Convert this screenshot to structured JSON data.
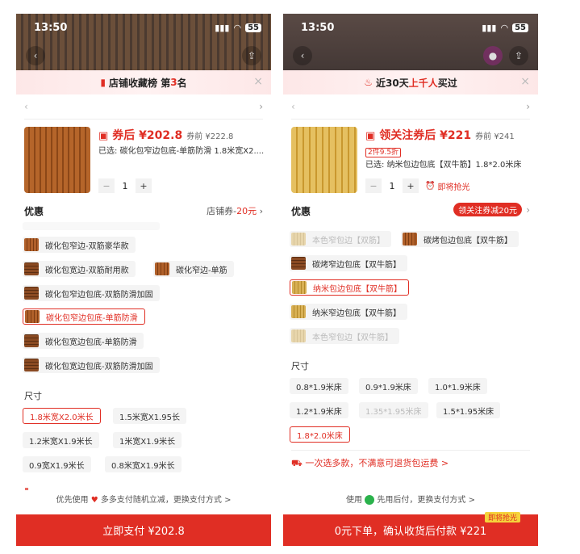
{
  "left": {
    "status_time": "13:50",
    "battery": "55",
    "banner": {
      "prefix": "店铺收藏榜 第 ",
      "rank": "3",
      "suffix": " 名"
    },
    "price_after_coupon": "券后 ¥202.8",
    "price_before": "券前 ¥222.8",
    "selected": "已选: 碳化包窄边包底-单筋防滑 1.8米宽X2....",
    "quantity": "1",
    "discount_label": "优惠",
    "discount_value_prefix": "店铺券-",
    "discount_value_amount": "20元",
    "options": [
      "碳化包窄边-双筋豪华款",
      "碳化包宽边-双筋耐用款",
      "碳化窄边-单筋",
      "碳化包窄边包底-双筋防滑加固",
      "碳化包窄边包底-单筋防滑",
      "碳化包宽边包底-单筋防滑",
      "碳化包宽边包底-双筋防滑加固"
    ],
    "size_title": "尺寸",
    "sizes": [
      "1.8米宽X2.0米长",
      "1.5米宽X1.95长",
      "1.2米宽X1.9米长",
      "1米宽X1.9米长",
      "0.9宽X1.9米长",
      "0.8米宽X1.9米长"
    ],
    "pay_hint_prefix": "优先使用",
    "pay_hint_suffix": "多多支付随机立减，更换支付方式 >",
    "pay_button": "立即支付 ¥202.8"
  },
  "right": {
    "status_time": "13:50",
    "battery": "55",
    "banner": {
      "prefix": "近30天",
      "highlight": "上千人",
      "suffix": "买过"
    },
    "price_after_coupon": "领关注券后 ¥221",
    "price_before": "券前 ¥241",
    "tag": "2件9.5折",
    "selected": "已选: 纳米包边包底【双牛筋】1.8*2.0米床",
    "quantity": "1",
    "grab_text": "即将抢光",
    "discount_label": "优惠",
    "discount_pill": "领关注券减20元",
    "options": [
      "本色窄包边【双筋】",
      "碳烤包边包底【双牛筋】",
      "碳烤窄边包底【双牛筋】",
      "纳米包边包底【双牛筋】",
      "纳米窄边包底【双牛筋】",
      "本色窄包边【双牛筋】"
    ],
    "size_title": "尺寸",
    "sizes": [
      "0.8*1.9米床",
      "0.9*1.9米床",
      "1.0*1.9米床",
      "1.2*1.9米床",
      "1.35*1.95米床",
      "1.5*1.95米床",
      "1.8*2.0米床"
    ],
    "promo": "一次选多款，不满意可退货包运费 >",
    "pay_hint_prefix": "使用",
    "pay_hint_suffix": "先用后付，更换支付方式 >",
    "grab_tag": "即将抢光",
    "pay_button": "0元下单，确认收货后付款 ¥221"
  },
  "colors": {
    "accent": "#e02e24",
    "selected_border": "#e02e24"
  }
}
